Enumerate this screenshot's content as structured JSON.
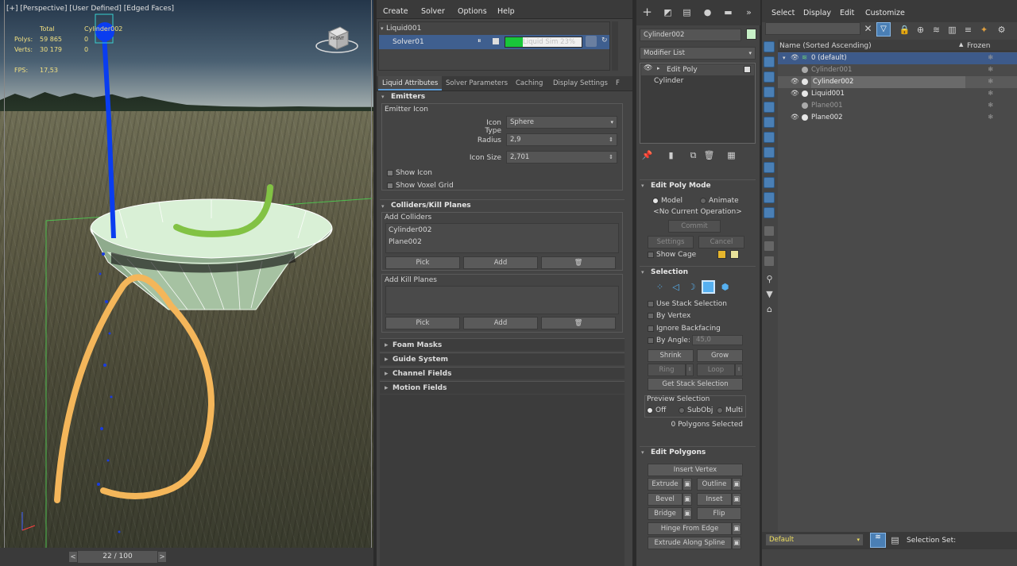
{
  "viewport": {
    "label": "[+] [Perspective] [User Defined] [Edged Faces]",
    "stats": {
      "total_label": "Total",
      "object_label": "Cylinder002",
      "polys_label": "Polys:",
      "polys_total": "59 865",
      "polys_obj": "0",
      "verts_label": "Verts:",
      "verts_total": "30 179",
      "verts_obj": "0",
      "fps_label": "FPS:",
      "fps_value": "17,53"
    },
    "viewcube_label": "FRONT"
  },
  "timeline": {
    "frame": "22 / 100",
    "prev_icon": "arrow-left-icon",
    "next_icon": "arrow-right-icon"
  },
  "menu": {
    "items": [
      "Create",
      "Solver",
      "Options",
      "Help"
    ]
  },
  "solver_list": {
    "liquid": "Liquid001",
    "solver": "Solver01",
    "progress_label": "Liquid Sim 23%",
    "progress_fraction": 0.23,
    "progress_color": "#19c63a"
  },
  "tabs": [
    "Liquid Attributes",
    "Solver Parameters",
    "Caching",
    "Display Settings",
    "F"
  ],
  "emitters": {
    "title": "Emitters",
    "group_label": "Emitter Icon",
    "icon_type_label": "Icon Type",
    "icon_type_value": "Sphere",
    "radius_label": "Radius",
    "radius_value": "2,9",
    "icon_size_label": "Icon Size",
    "icon_size_value": "2,701",
    "show_icon": "Show Icon",
    "show_voxel_grid": "Show Voxel Grid"
  },
  "colliders": {
    "title": "Colliders/Kill Planes",
    "add_colliders_label": "Add Colliders",
    "items": [
      "Cylinder002",
      "Plane002"
    ],
    "pick": "Pick",
    "add": "Add",
    "add_kill_planes_label": "Add Kill Planes",
    "pick2": "Pick",
    "add2": "Add"
  },
  "rollouts": [
    "Foam Masks",
    "Guide System",
    "Channel Fields",
    "Motion Fields"
  ],
  "command_panel": {
    "object_name": "Cylinder002",
    "modifier_list": "Modifier List",
    "stack": [
      "Edit Poly",
      "Cylinder"
    ]
  },
  "edit_poly_mode": {
    "title": "Edit Poly Mode",
    "model": "Model",
    "animate": "Animate",
    "current_op": "<No Current Operation>",
    "commit": "Commit",
    "settings": "Settings",
    "cancel": "Cancel",
    "show_cage": "Show Cage",
    "cage_color1": "#e7b62c",
    "cage_color2": "#e8e29a"
  },
  "selection": {
    "title": "Selection",
    "use_stack": "Use Stack Selection",
    "by_vertex": "By Vertex",
    "ignore_backfacing": "Ignore Backfacing",
    "by_angle": "By Angle:",
    "angle_value": "45,0",
    "shrink": "Shrink",
    "grow": "Grow",
    "ring": "Ring",
    "loop": "Loop",
    "get_stack": "Get Stack Selection",
    "preview_label": "Preview Selection",
    "off": "Off",
    "subobj": "SubObj",
    "multi": "Multi",
    "status": "0 Polygons Selected"
  },
  "edit_polygons": {
    "title": "Edit Polygons",
    "insert_vertex": "Insert Vertex",
    "extrude": "Extrude",
    "outline": "Outline",
    "bevel": "Bevel",
    "inset": "Inset",
    "bridge": "Bridge",
    "flip": "Flip",
    "hinge": "Hinge From Edge",
    "extrude_spline": "Extrude Along Spline"
  },
  "scene_explorer": {
    "menu": [
      "Select",
      "Display",
      "Edit",
      "Customize"
    ],
    "col_name": "Name (Sorted Ascending)",
    "col_frozen": "Frozen",
    "layer": "0 (default)",
    "objects": [
      "Cylinder001",
      "Cylinder002",
      "Liquid001",
      "Plane001",
      "Plane002"
    ],
    "footer_dropdown": "Default",
    "selection_set": "Selection Set:"
  }
}
